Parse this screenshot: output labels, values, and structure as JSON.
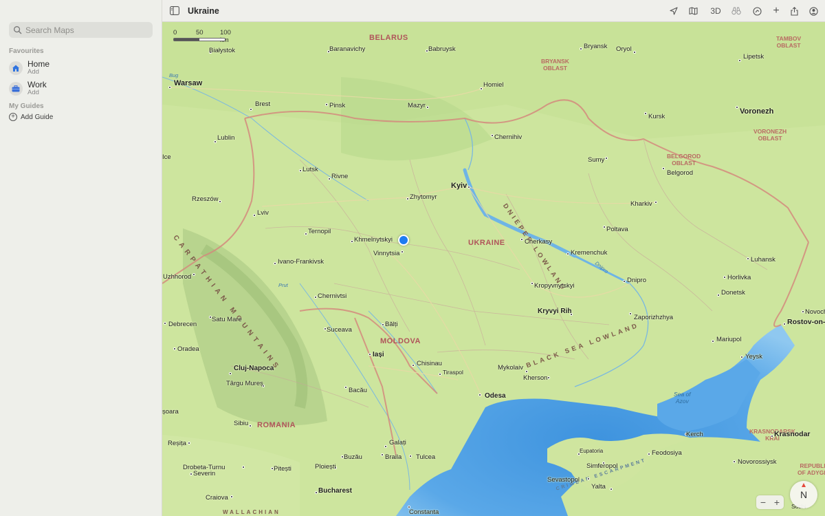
{
  "sidebar": {
    "search_placeholder": "Search Maps",
    "favourites_label": "Favourites",
    "favourites": [
      {
        "title": "Home",
        "subtitle": "Add",
        "icon": "house-icon"
      },
      {
        "title": "Work",
        "subtitle": "Add",
        "icon": "briefcase-icon"
      }
    ],
    "guides_label": "My Guides",
    "add_guide_label": "Add Guide"
  },
  "toolbar": {
    "title": "Ukraine",
    "threed_label": "3D"
  },
  "map": {
    "scale_labels": [
      "0",
      "50",
      "100 km"
    ],
    "compass_label": "N",
    "countries": [
      "BELARUS",
      "UKRAINE",
      "MOLDOVA",
      "ROMANIA"
    ],
    "oblasts": {
      "tambov": "TAMBOV\nOBLAST",
      "bryansk": "BRYANSK\nOBLAST",
      "voronezh": "VORONEZH\nOBLAST",
      "belgorod": "BELGOROD\nOBLAST",
      "krasnodar": "KRASNODARSK\nKRAI",
      "adygea": "REPUBLIC\nOF ADYGEA"
    },
    "sea": "Sea of\nAzov",
    "terrain": {
      "dnieper": "DNIEPER LOWLAND",
      "black_sea": "BLACK SEA LOWLAND",
      "carpathian": "CARPATHIAN MOUNTAINS",
      "crimean": "CRIMEAN ESCARPMENT",
      "wallachian": "WALLACHIAN"
    },
    "rivers": {
      "bug": "Bug",
      "prut": "Prut",
      "dnipro": "Dnipro"
    },
    "cities": {
      "bialystok": "Białystok",
      "warsaw": "Warsaw",
      "baranavichy": "Baranavichy",
      "babruysk": "Babruysk",
      "bryansk": "Bryansk",
      "oryol": "Oryol",
      "lipetsk": "Lipetsk",
      "homiel": "Homiel",
      "brest": "Brest",
      "pinsk": "Pinsk",
      "mazyr": "Mazyr",
      "voronezh": "Voronezh",
      "kursk": "Kursk",
      "chernihiv": "Chernihiv",
      "lublin": "Lublin",
      "ice": "Ice",
      "sumy": "Sumy",
      "belgorod": "Belgorod",
      "lutsk": "Lutsk",
      "rivne": "Rivne",
      "kyiv": "Kyiv",
      "zhytomyr": "Zhytomyr",
      "rzeszow": "Rzeszów",
      "kharkiv": "Kharkiv",
      "lviv": "Lviv",
      "ternopil": "Ternopil",
      "poltava": "Poltava",
      "khmelnytskyi": "Khmelnytskyi",
      "cherkasy": "Cherkasy",
      "vinnytsia": "Vinnytsia",
      "kremenchuk": "Kremenchuk",
      "ivano": "Ivano-Frankivsk",
      "luhansk": "Luhansk",
      "uzhhorod": "Uzhhorod",
      "horlivka": "Horlivka",
      "dnipro": "Dnipro",
      "kropyvnytskyi": "Kropyvnytskyi",
      "chernivtsi": "Chernivtsi",
      "donetsk": "Donetsk",
      "kryvyi": "Kryvyi Rih",
      "zaporizhzhya": "Zaporizhzhya",
      "novocher": "Novocher",
      "debrecen": "Debrecen",
      "satumare": "Satu Mare",
      "balti": "Bălți",
      "rostov": "Rostov-on-",
      "suceava": "Suceava",
      "mariupol": "Mariupol",
      "oradea": "Oradea",
      "iasi": "Iași",
      "yeysk": "Yeysk",
      "chisinau": "Chisinau",
      "mykolaiv": "Mykolaiv",
      "tiraspol": "Tiraspol",
      "cluj": "Cluj-Napoca",
      "kherson": "Kherson",
      "targu": "Târgu Mureș",
      "bacau": "Bacău",
      "odesa": "Odesa",
      "soara": "șoara",
      "sibiu": "Sibiu",
      "kerch": "Kerch",
      "krasnodar": "Krasnodar",
      "resita": "Reșița",
      "galati": "Galați",
      "eupatoria": "Eupatoria",
      "feodosiya": "Feodosiya",
      "braila": "Braila",
      "tulcea": "Tulcea",
      "buzau": "Buzău",
      "simferopol": "Simferopol",
      "novorossiysk": "Novorossiysk",
      "drobeta": "Drobeta-Turnu",
      "severin": "Severin",
      "pitesti": "Pitești",
      "ploiesti": "Ploiești",
      "sevastopol": "Sevastopol",
      "yalta": "Yalta",
      "bucharest": "Bucharest",
      "craiova": "Craiova",
      "constanta": "Constanta",
      "sochi": "Sochi"
    }
  }
}
